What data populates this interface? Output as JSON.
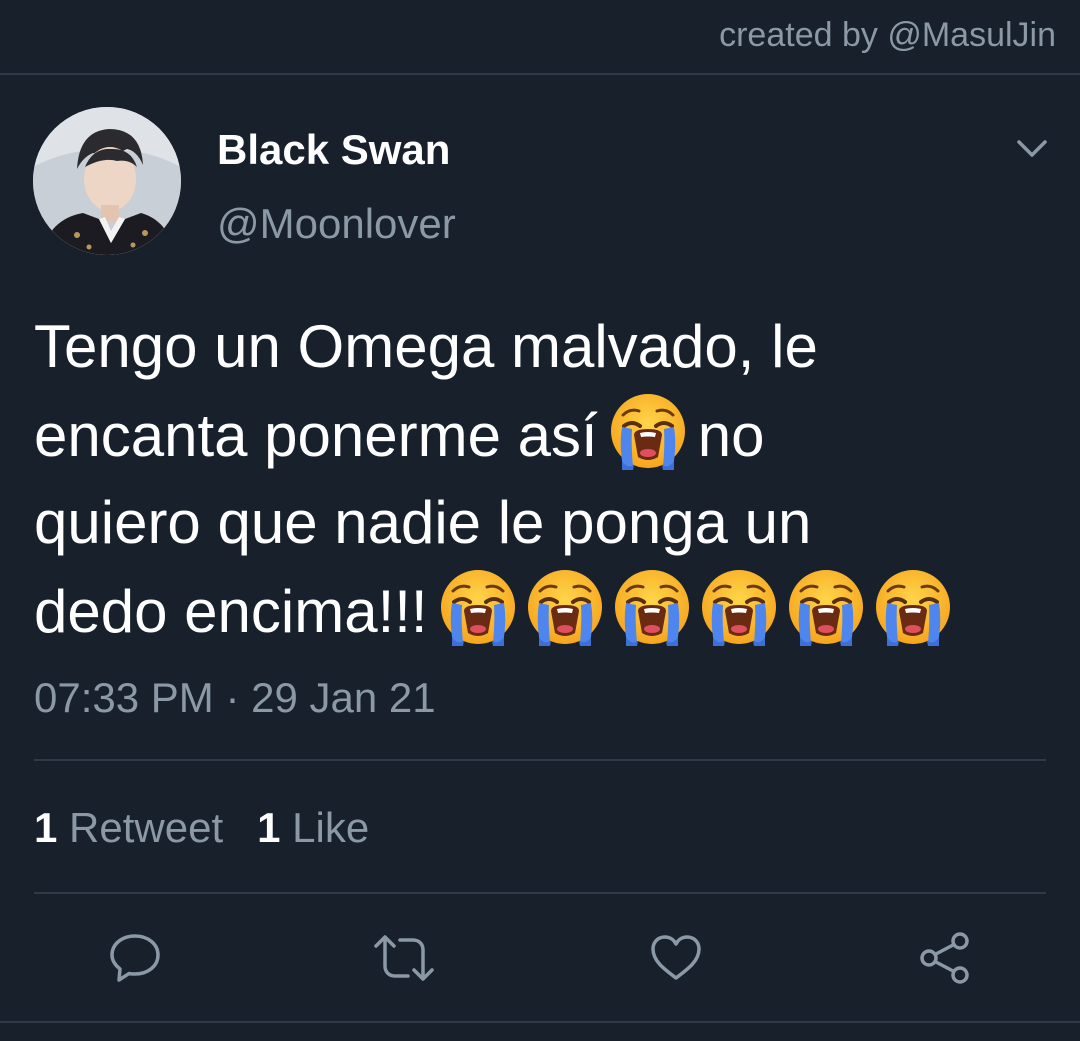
{
  "credit": "created by @MasulJin",
  "user": {
    "display_name": "Black Swan",
    "handle": "@Moonlover",
    "avatar_icon": "profile-photo"
  },
  "tweet": {
    "text_segments": [
      "Tengo un Omega malvado, le",
      "encanta ponerme así",
      "no",
      "quiero que nadie le ponga un",
      "dedo encima!!!"
    ],
    "emoji": "loudly-crying-face",
    "timestamp": "07:33 PM · 29 Jan 21"
  },
  "stats": {
    "retweets_count": "1",
    "retweets_label": "Retweet",
    "likes_count": "1",
    "likes_label": "Like"
  },
  "actions": [
    "reply-icon",
    "retweet-icon",
    "like-icon",
    "share-icon"
  ],
  "colors": {
    "background": "#17202b",
    "secondary_text": "#8b98a5",
    "divider": "#2f3b47",
    "icon": "#8b98a5"
  }
}
